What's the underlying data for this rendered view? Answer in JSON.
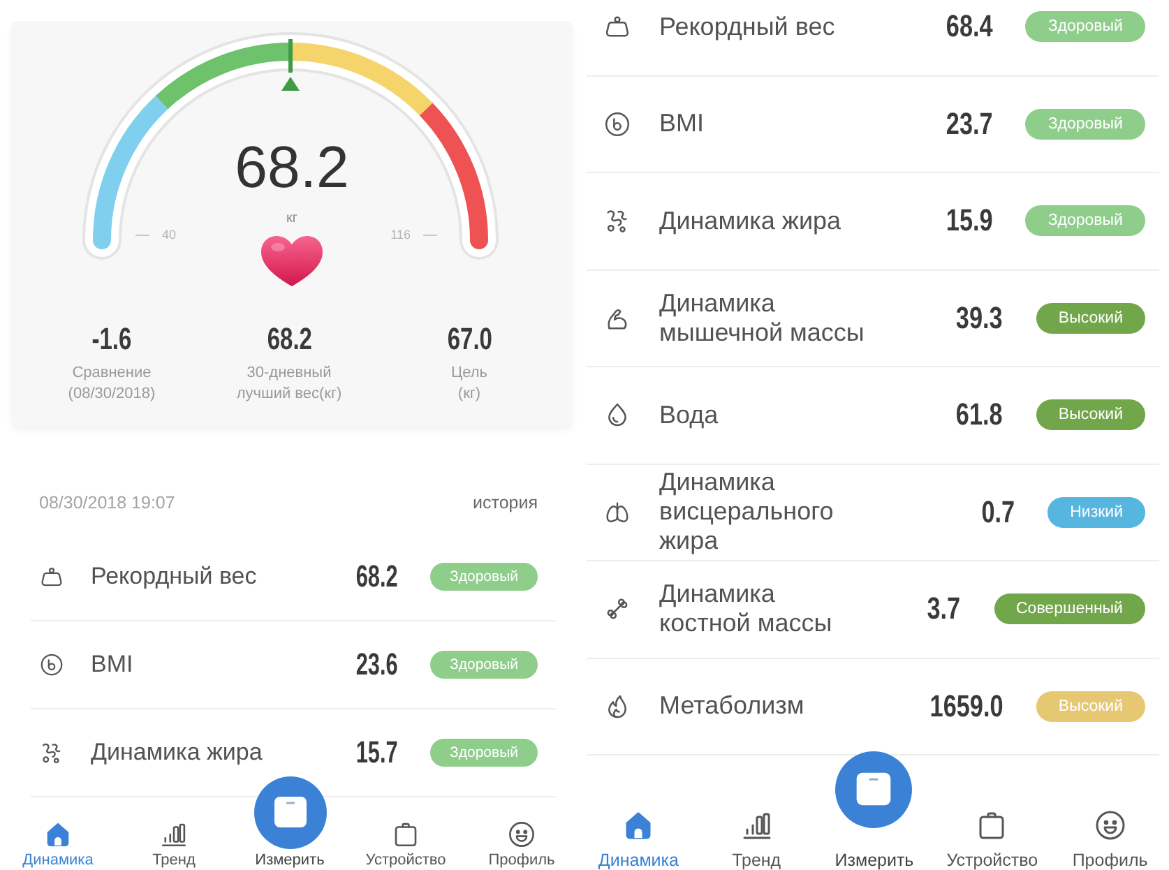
{
  "screens": [
    {
      "gauge": {
        "value": "68.2",
        "unit": "кг",
        "min_label": "40",
        "max_label": "116",
        "level": 0.5
      },
      "summary": [
        {
          "value": "-1.6",
          "label": "Сравнение\n(08/30/2018)"
        },
        {
          "value": "68.2",
          "label": "30-дневный\nлучший вес(кг)"
        },
        {
          "value": "67.0",
          "label": "Цель\n(кг)"
        }
      ],
      "measured_at": "08/30/2018 19:07",
      "history_link": "история",
      "metrics": [
        {
          "kind": "weight",
          "label": "Рекордный вес",
          "value": "68.2",
          "status": {
            "label": "Здоровый",
            "color": "#8fcd8b"
          }
        },
        {
          "kind": "bmi",
          "label": "BMI",
          "value": "23.6",
          "status": {
            "label": "Здоровый",
            "color": "#8fcd8b"
          }
        },
        {
          "kind": "fat",
          "label": "Динамика жира",
          "value": "15.7",
          "status": {
            "label": "Здоровый",
            "color": "#8fcd8b"
          }
        }
      ],
      "tab_bar": [
        {
          "kind": "home",
          "label": "Динамика",
          "selected": true
        },
        {
          "kind": "trend",
          "label": "Тренд",
          "selected": false
        },
        {
          "kind": "measure",
          "label": "Измерить",
          "selected": false
        },
        {
          "kind": "device",
          "label": "Устройство",
          "selected": false
        },
        {
          "kind": "profile",
          "label": "Профиль",
          "selected": false
        }
      ]
    },
    {
      "metrics": [
        {
          "kind": "weight",
          "label": "Рекордный вес",
          "value": "68.4",
          "status": {
            "label": "Здоровый",
            "color": "#8fcd8b"
          }
        },
        {
          "kind": "bmi",
          "label": "BMI",
          "value": "23.7",
          "status": {
            "label": "Здоровый",
            "color": "#8fcd8b"
          }
        },
        {
          "kind": "fat",
          "label": "Динамика жира",
          "value": "15.9",
          "status": {
            "label": "Здоровый",
            "color": "#8fcd8b"
          }
        },
        {
          "kind": "muscle",
          "label": "Динамика\nмышечной массы",
          "value": "39.3",
          "status": {
            "label": "Высокий",
            "color": "#72a64a"
          }
        },
        {
          "kind": "water",
          "label": "Вода",
          "value": "61.8",
          "status": {
            "label": "Высокий",
            "color": "#72a64a"
          }
        },
        {
          "kind": "visceral",
          "label": "Динамика\nвисцерального\nжира",
          "value": "0.7",
          "status": {
            "label": "Низкий",
            "color": "#56b6e0"
          }
        },
        {
          "kind": "bone",
          "label": "Динамика\nкостной массы",
          "value": "3.7",
          "status": {
            "label": "Совершенный",
            "color": "#72a64a"
          }
        },
        {
          "kind": "metabolism",
          "label": "Метаболизм",
          "value": "1659.0",
          "status": {
            "label": "Высокий",
            "color": "#e6c873"
          }
        }
      ],
      "tab_bar": [
        {
          "kind": "home",
          "label": "Динамика",
          "selected": true
        },
        {
          "kind": "trend",
          "label": "Тренд",
          "selected": false
        },
        {
          "kind": "measure",
          "label": "Измерить",
          "selected": false
        },
        {
          "kind": "device",
          "label": "Устройство",
          "selected": false
        },
        {
          "kind": "profile",
          "label": "Профиль",
          "selected": false
        }
      ]
    }
  ]
}
